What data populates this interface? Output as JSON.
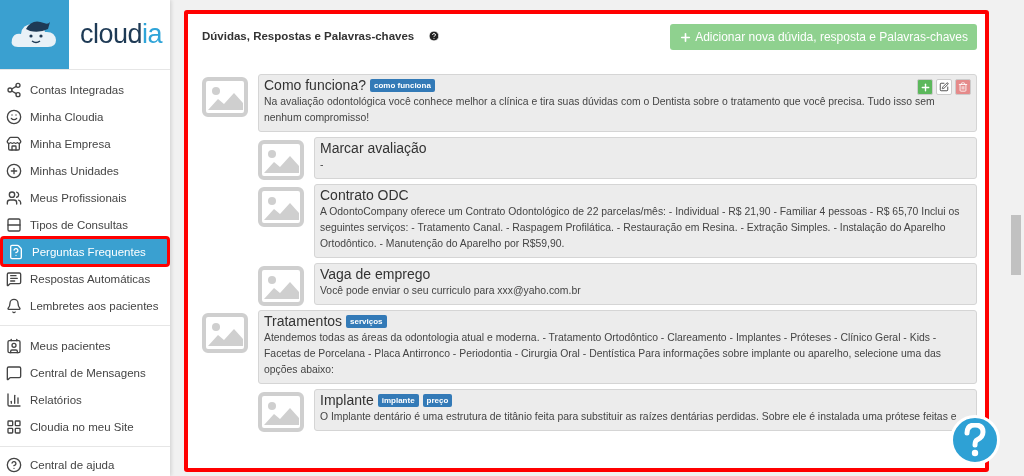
{
  "brand": {
    "main": "cloud",
    "accent": "ia"
  },
  "sidebar": {
    "groups": [
      {
        "items": [
          {
            "label": "Contas Integradas",
            "selected": false
          },
          {
            "label": "Minha Cloudia",
            "selected": false
          },
          {
            "label": "Minha Empresa",
            "selected": false
          },
          {
            "label": "Minhas Unidades",
            "selected": false
          },
          {
            "label": "Meus Profissionais",
            "selected": false
          },
          {
            "label": "Tipos de Consultas",
            "selected": false
          },
          {
            "label": "Perguntas Frequentes",
            "selected": true
          },
          {
            "label": "Respostas Automáticas",
            "selected": false
          },
          {
            "label": "Lembretes aos pacientes",
            "selected": false
          }
        ]
      },
      {
        "items": [
          {
            "label": "Meus pacientes",
            "selected": false
          },
          {
            "label": "Central de Mensagens",
            "selected": false
          },
          {
            "label": "Relatórios",
            "selected": false
          },
          {
            "label": "Cloudia no meu Site",
            "selected": false
          }
        ]
      },
      {
        "items": [
          {
            "label": "Central de ajuda",
            "selected": false
          }
        ]
      }
    ]
  },
  "panel": {
    "title": "Dúvidas, Respostas e Palavras-chaves",
    "add_button": "Adicionar nova dúvida, resposta e Palavras-chaves",
    "faqs": [
      {
        "title": "Como funciona?",
        "tags": [
          "como funciona"
        ],
        "show_actions": true,
        "text": "Na avaliação odontológica você conhece melhor a clínica e tira suas dúvidas com o Dentista sobre o tratamento que você precisa. Tudo isso sem nenhum compromisso!",
        "children": [
          {
            "title": "Marcar avaliação",
            "show_actions": false,
            "text": "-"
          },
          {
            "title": "Contrato ODC",
            "show_actions": false,
            "text": "A OdontoCompany oferece um Contrato Odontológico de 22 parcelas/mês: - Individual - R$ 21,90 - Familiar 4 pessoas - R$ 65,70 Inclui os seguintes serviços: - Tratamento Canal. - Raspagem Profilática. - Restauração em Resina. - Extração Simples. - Instalação do Aparelho Ortodôntico. - Manutenção do Aparelho por R$59,90."
          },
          {
            "title": "Vaga de emprego",
            "show_actions": false,
            "text": "Você pode enviar o seu curriculo para xxx@yaho.com.br"
          }
        ]
      },
      {
        "title": "Tratamentos",
        "tags": [
          "serviços"
        ],
        "show_actions": false,
        "text": "Atendemos todas as áreas da odontologia atual e moderna. - Tratamento Ortodôntico - Clareamento - Implantes - Próteses - Clínico Geral - Kids - Facetas de Porcelana - Placa Antirronco - Periodontia - Cirurgia Oral - Dentística Para informações sobre implante ou aparelho, selecione uma das opções abaixo:",
        "children": [
          {
            "title": "Implante",
            "tags": [
              "implante",
              "preço"
            ],
            "show_actions": false,
            "text": "O Implante dentário é uma estrutura de titânio feita para substituir as raízes dentárias perdidas. Sobre ele é instalada uma prótese feitas e"
          }
        ]
      }
    ]
  }
}
